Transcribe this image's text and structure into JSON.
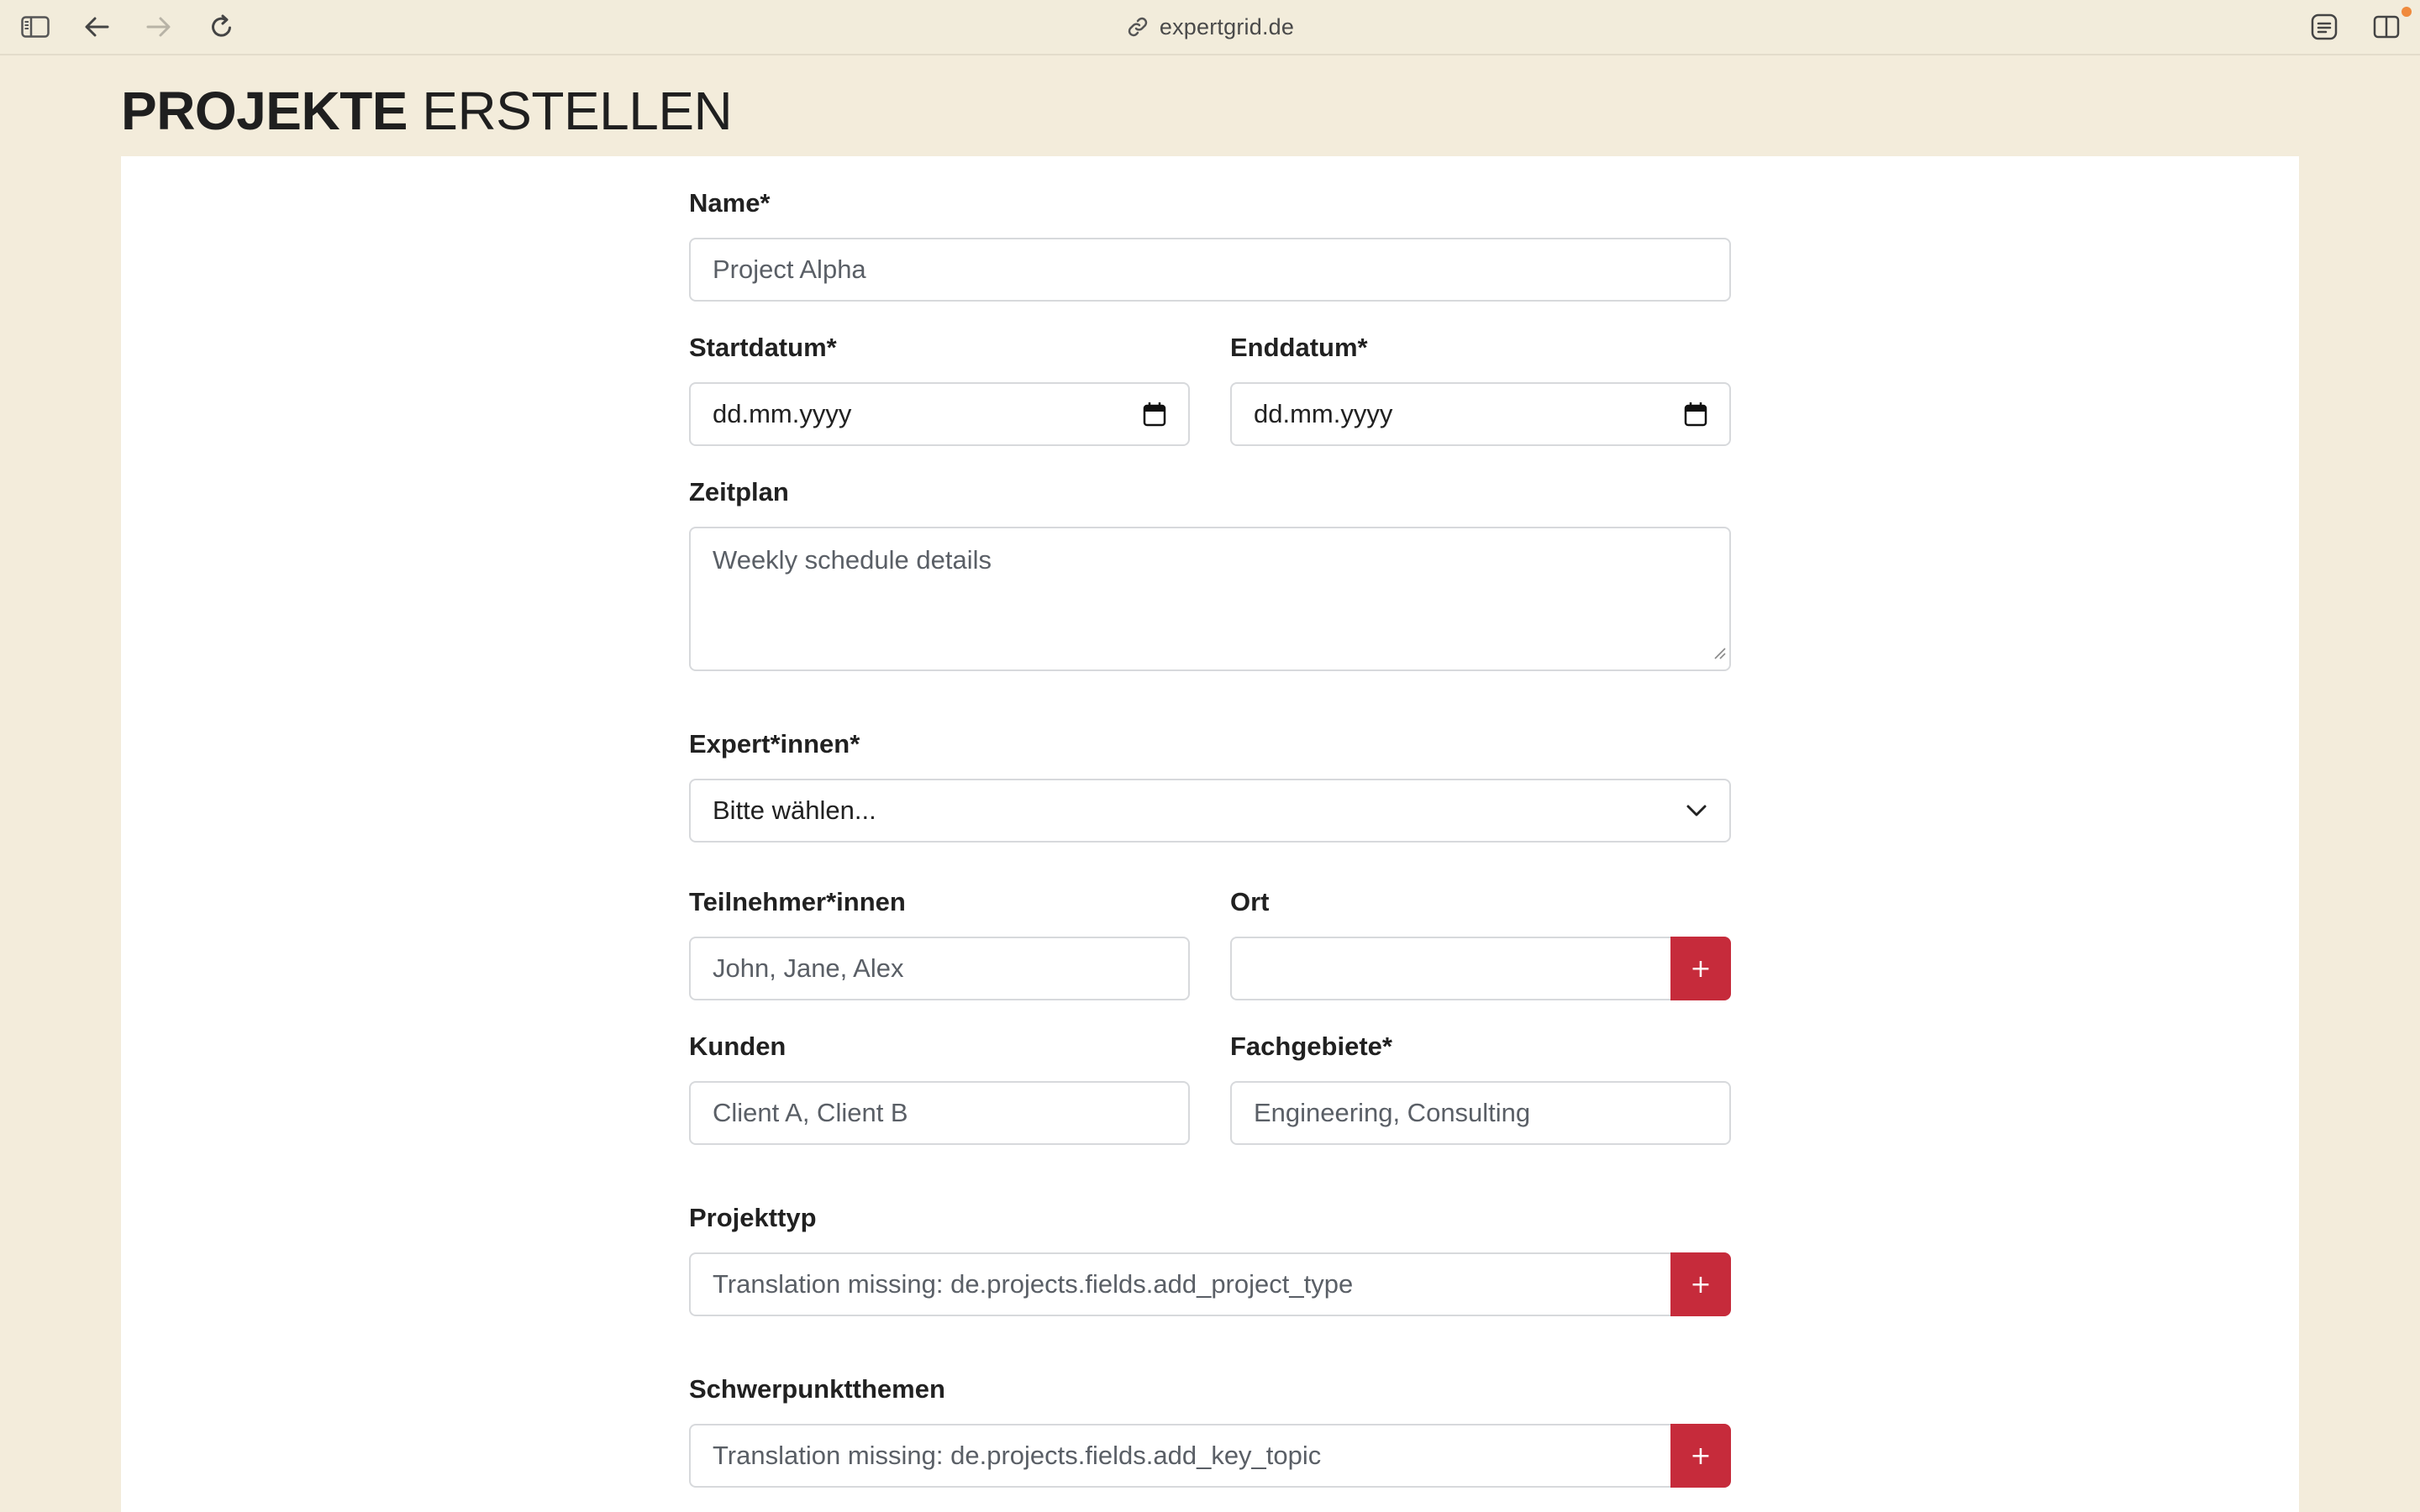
{
  "browser": {
    "url": "expertgrid.de"
  },
  "page": {
    "title_bold": "PROJEKTE",
    "title_light": "ERSTELLEN"
  },
  "form": {
    "name": {
      "label": "Name*",
      "value": "Project Alpha"
    },
    "startdatum": {
      "label": "Startdatum*",
      "placeholder": "dd.mm.yyyy"
    },
    "enddatum": {
      "label": "Enddatum*",
      "placeholder": "dd.mm.yyyy"
    },
    "zeitplan": {
      "label": "Zeitplan",
      "value": "Weekly schedule details"
    },
    "experten": {
      "label": "Expert*innen*",
      "selected": "Bitte wählen..."
    },
    "teilnehmer": {
      "label": "Teilnehmer*innen",
      "value": "John, Jane, Alex"
    },
    "ort": {
      "label": "Ort",
      "value": "",
      "add_label": "+"
    },
    "kunden": {
      "label": "Kunden",
      "value": "Client A, Client B"
    },
    "fachgebiete": {
      "label": "Fachgebiete*",
      "value": "Engineering, Consulting"
    },
    "projekttyp": {
      "label": "Projekttyp",
      "value": "Translation missing: de.projects.fields.add_project_type",
      "add_label": "+"
    },
    "schwerpunkt": {
      "label": "Schwerpunktthemen",
      "value": "Translation missing: de.projects.fields.add_key_topic",
      "add_label": "+"
    }
  },
  "colors": {
    "background": "#f3ecdb",
    "accent_button": "#c62b3b"
  },
  "icons": [
    "sidebar-toggle-icon",
    "back-arrow-icon",
    "forward-arrow-icon",
    "reload-icon",
    "link-icon",
    "reader-icon",
    "split-view-icon",
    "calendar-icon",
    "chevron-down-icon"
  ]
}
